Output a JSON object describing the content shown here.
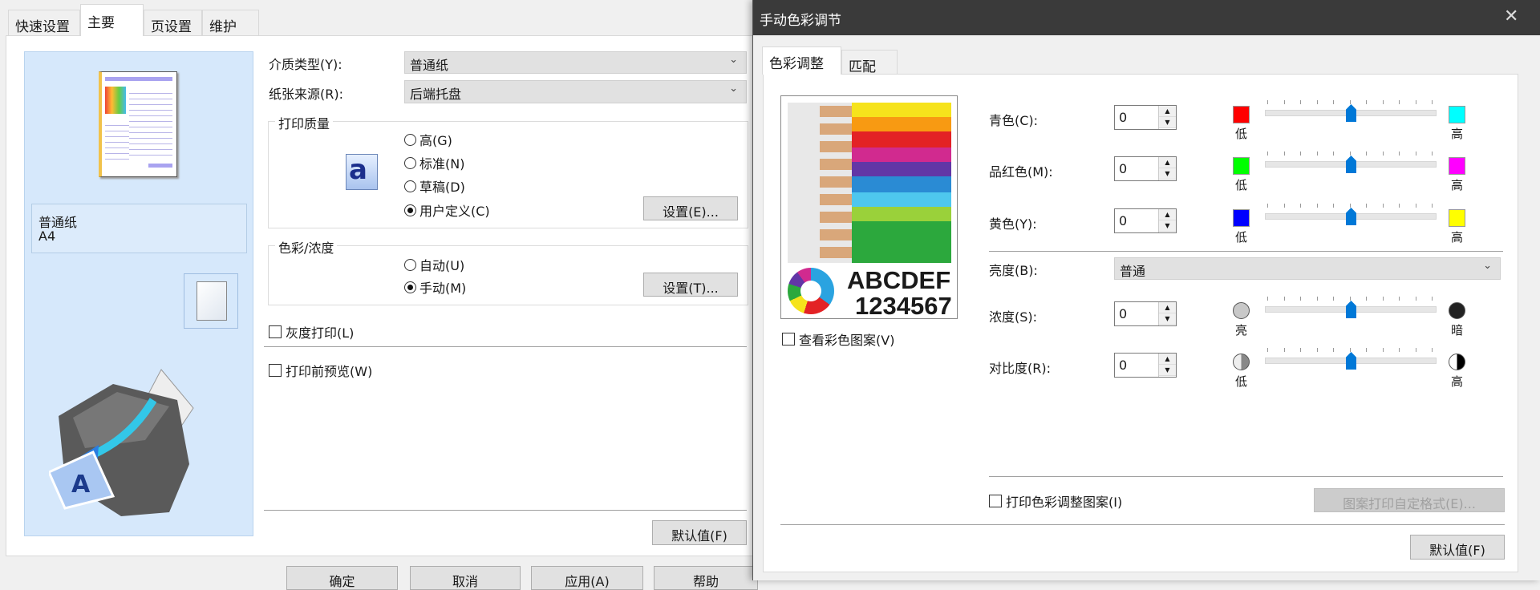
{
  "main_window": {
    "tabs": [
      {
        "label": "快速设置"
      },
      {
        "label": "主要"
      },
      {
        "label": "页设置"
      },
      {
        "label": "维护"
      }
    ],
    "preview": {
      "media": "普通纸",
      "size": "A4"
    },
    "media_type": {
      "label": "介质类型(Y):",
      "value": "普通纸"
    },
    "paper_source": {
      "label": "纸张来源(R):",
      "value": "后端托盘"
    },
    "print_quality": {
      "label": "打印质量",
      "options": [
        "高(G)",
        "标准(N)",
        "草稿(D)",
        "用户定义(C)"
      ],
      "selected": "用户定义(C)",
      "settings_button": "设置(E)..."
    },
    "color_intensity": {
      "label": "色彩/浓度",
      "options": [
        "自动(U)",
        "手动(M)"
      ],
      "selected": "手动(M)",
      "settings_button": "设置(T)..."
    },
    "grayscale": {
      "label": "灰度打印(L)",
      "checked": false
    },
    "preview_before_print": {
      "label": "打印前预览(W)",
      "checked": false
    },
    "defaults_button": "默认值(F)",
    "bottom_buttons": [
      "确定",
      "取消",
      "应用(A)",
      "帮助"
    ]
  },
  "dialog": {
    "title": "手动色彩调节",
    "close_icon": "close-icon",
    "tabs": [
      {
        "label": "色彩调整"
      },
      {
        "label": "匹配"
      }
    ],
    "sample": {
      "text1": "ABCDEF",
      "text2": "1234567"
    },
    "view_pattern": {
      "label": "查看彩色图案(V)",
      "checked": false
    },
    "sliders": [
      {
        "label": "青色(C):",
        "value": "0",
        "low": "低",
        "high": "高",
        "low_color": "#ff0000",
        "high_color": "#00ffff",
        "position": 0
      },
      {
        "label": "品红色(M):",
        "value": "0",
        "low": "低",
        "high": "高",
        "low_color": "#00ff00",
        "high_color": "#ff00ff",
        "position": 0
      },
      {
        "label": "黄色(Y):",
        "value": "0",
        "low": "低",
        "high": "高",
        "low_color": "#0000ff",
        "high_color": "#ffff00",
        "position": 0
      }
    ],
    "brightness": {
      "label": "亮度(B):",
      "value": "普通"
    },
    "intensity": {
      "label": "浓度(S):",
      "value": "0",
      "low": "亮",
      "high": "暗",
      "position": 0
    },
    "contrast": {
      "label": "对比度(R):",
      "value": "0",
      "low": "低",
      "high": "高",
      "position": 0
    },
    "print_pattern": {
      "label": "打印色彩调整图案(I)",
      "checked": false
    },
    "pattern_format_button": "图案打印自定格式(E)...",
    "defaults_button": "默认值(F)"
  }
}
